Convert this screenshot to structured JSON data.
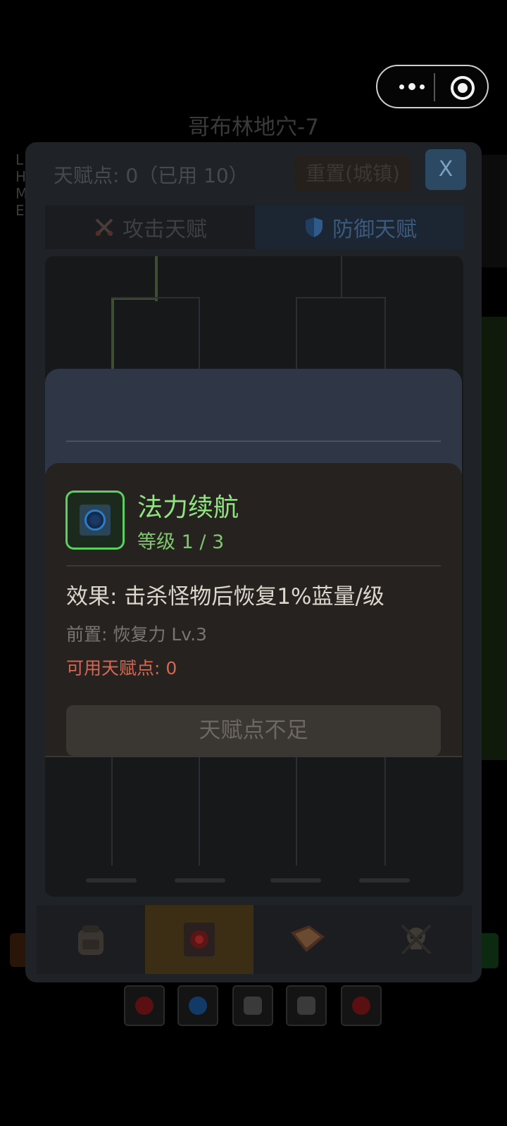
{
  "header": {
    "dungeon_title": "哥布林地穴-7"
  },
  "capsule": {
    "more_icon": "more-dots-icon",
    "close_icon": "target-circle-icon"
  },
  "left_stats": [
    "L",
    "H",
    "M",
    "E"
  ],
  "talent_panel": {
    "points_text": "天赋点: 0（已用 10）",
    "reset_label": "重置(城镇)",
    "close_label": "X",
    "tabs": [
      {
        "label": "攻击天赋",
        "icon": "crossed-swords-icon",
        "active": false
      },
      {
        "label": "防御天赋",
        "icon": "shield-icon",
        "active": true
      }
    ]
  },
  "talent_dialog": {
    "name": "法力续航",
    "level": "等级 1 / 3",
    "effect": "效果: 击杀怪物后恢复1%蓝量/级",
    "prereq": "前置: 恢复力 Lv.3",
    "available": "可用天赋点: 0",
    "button_label": "天赋点不足",
    "icon": "mana-orb-icon",
    "icon_border_color": "#5bcf5f"
  },
  "bottom_nav": [
    {
      "icon": "backpack-icon",
      "active": false
    },
    {
      "icon": "talent-tome-icon",
      "active": true
    },
    {
      "icon": "spellbook-icon",
      "active": false
    },
    {
      "icon": "skull-emblem-icon",
      "active": false
    }
  ],
  "quick_slots": [
    {
      "icon": "red-potion-icon"
    },
    {
      "icon": "blue-potion-icon"
    },
    {
      "icon": "scroll-icon"
    },
    {
      "icon": "scroll-icon"
    },
    {
      "icon": "red-potion-icon"
    }
  ],
  "colors": {
    "accent_green": "#8fe57f",
    "warning_red": "#d96650",
    "defense_tab": "#3b5a7d"
  }
}
